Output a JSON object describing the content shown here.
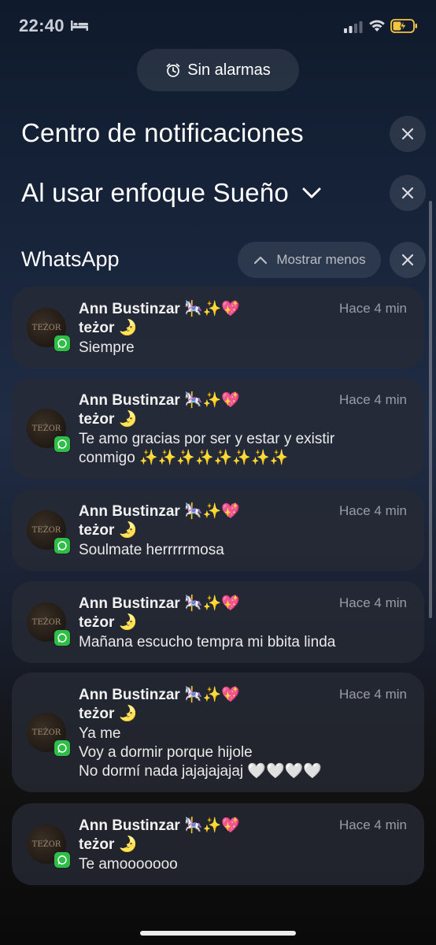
{
  "status_bar": {
    "time": "22:40",
    "icons": [
      "bed-icon",
      "signal-icon",
      "wifi-icon",
      "battery-charging-icon"
    ]
  },
  "alarm": {
    "label": "Sin alarmas",
    "icon": "alarm-clock-icon"
  },
  "headings": {
    "notification_center": "Centro de notificaciones",
    "focus_mode": "Al usar enfoque Sueño"
  },
  "group": {
    "app_name": "WhatsApp",
    "show_less_label": "Mostrar menos"
  },
  "notifications": [
    {
      "sender": "Ann Bustinzar 🎠✨💖",
      "subtitle": "teżor 🌛",
      "time": "Hace 4 min",
      "lines": [
        "Siempre"
      ]
    },
    {
      "sender": "Ann Bustinzar 🎠✨💖",
      "subtitle": "teżor 🌛",
      "time": "Hace 4 min",
      "lines": [
        "Te amo gracias por ser y estar y existir",
        "conmigo ✨✨✨✨✨✨✨✨"
      ]
    },
    {
      "sender": "Ann Bustinzar 🎠✨💖",
      "subtitle": "teżor 🌛",
      "time": "Hace 4 min",
      "lines": [
        "Soulmate herrrrrmosa"
      ]
    },
    {
      "sender": "Ann Bustinzar 🎠✨💖",
      "subtitle": "teżor 🌛",
      "time": "Hace 4 min",
      "lines": [
        "Mañana escucho tempra mi bbita linda"
      ]
    },
    {
      "sender": "Ann Bustinzar 🎠✨💖",
      "subtitle": "teżor 🌛",
      "time": "Hace 4 min",
      "lines": [
        "Ya me",
        "Voy a dormir porque hijole",
        "No dormí nada jajajajajaj 🤍🤍🤍🤍"
      ]
    },
    {
      "sender": "Ann Bustinzar 🎠✨💖",
      "subtitle": "teżor 🌛",
      "time": "Hace 4 min",
      "lines": [
        "Te amooooooo"
      ]
    }
  ],
  "avatar_text": "TEŻOR",
  "colors": {
    "whatsapp_green": "#2fbd48",
    "battery_yellow": "#f5c542"
  }
}
